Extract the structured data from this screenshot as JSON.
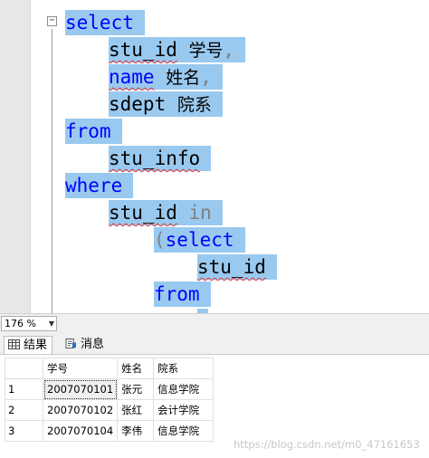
{
  "editor": {
    "fold_toggle": "−",
    "lines": [
      {
        "tokens": [
          {
            "t": "select",
            "c": "kw"
          }
        ]
      },
      {
        "tokens": [
          {
            "t": "stu_id",
            "c": "plain squig"
          },
          {
            "t": " ",
            "c": "plain"
          },
          {
            "t": "学号",
            "c": "plain cjk"
          },
          {
            "t": ",",
            "c": "dim"
          }
        ]
      },
      {
        "tokens": [
          {
            "t": "name",
            "c": "kw squig"
          },
          {
            "t": " ",
            "c": "plain"
          },
          {
            "t": "姓名",
            "c": "plain cjk"
          },
          {
            "t": ",",
            "c": "dim"
          }
        ]
      },
      {
        "tokens": [
          {
            "t": "sdept",
            "c": "plain"
          },
          {
            "t": " ",
            "c": "plain"
          },
          {
            "t": "院系",
            "c": "plain cjk"
          }
        ]
      },
      {
        "tokens": [
          {
            "t": "from",
            "c": "kw"
          }
        ]
      },
      {
        "tokens": [
          {
            "t": "stu_info",
            "c": "plain squig"
          }
        ]
      },
      {
        "tokens": [
          {
            "t": "where",
            "c": "kw"
          }
        ]
      },
      {
        "tokens": [
          {
            "t": "stu_id",
            "c": "plain squig"
          },
          {
            "t": " ",
            "c": "plain"
          },
          {
            "t": "in",
            "c": "dim"
          }
        ]
      },
      {
        "tokens": [
          {
            "t": "(",
            "c": "dim"
          },
          {
            "t": "select",
            "c": "kw"
          }
        ]
      },
      {
        "tokens": [
          {
            "t": "stu_id",
            "c": "plain squig"
          }
        ]
      },
      {
        "tokens": [
          {
            "t": "from",
            "c": "kw"
          }
        ]
      },
      {
        "tokens": [
          {
            "t": "",
            "c": "plain"
          }
        ]
      }
    ]
  },
  "zoom": {
    "value": "176 %"
  },
  "tabs": [
    {
      "label": "结果",
      "active": true,
      "icon": "grid-icon"
    },
    {
      "label": "消息",
      "active": false,
      "icon": "message-icon"
    }
  ],
  "results": {
    "columns": [
      "学号",
      "姓名",
      "院系"
    ],
    "rows": [
      {
        "num": "1",
        "cells": [
          "2007070101",
          "张元",
          "信息学院"
        ]
      },
      {
        "num": "2",
        "cells": [
          "2007070102",
          "张红",
          "会计学院"
        ]
      },
      {
        "num": "3",
        "cells": [
          "2007070104",
          "李伟",
          "信息学院"
        ]
      }
    ]
  },
  "watermark": "https://blog.csdn.net/m0_47161653"
}
